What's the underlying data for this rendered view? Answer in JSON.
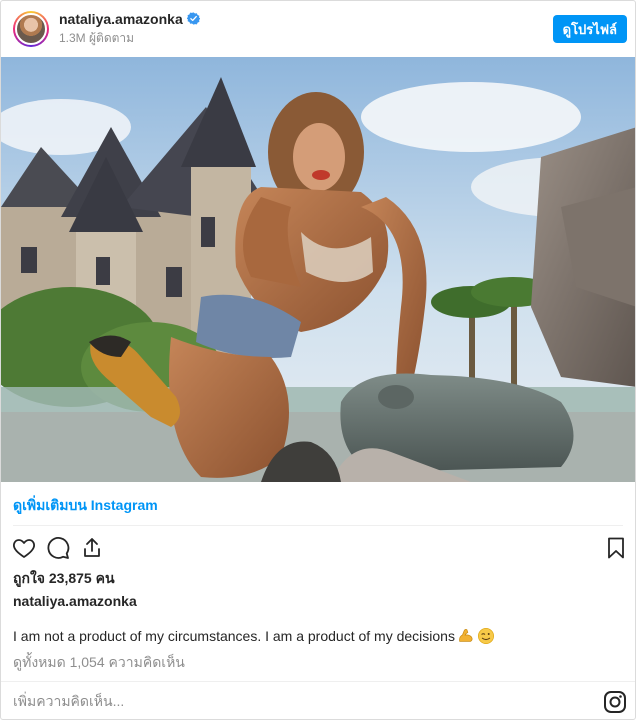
{
  "header": {
    "username": "nataliya.amazonka",
    "followers": "1.3M ผู้ติดตาม",
    "view_profile_label": "ดูโปรไฟล์"
  },
  "more_link": "ดูเพิ่มเติมบน Instagram",
  "likes": "ถูกใจ 23,875 คน",
  "caption_username": "nataliya.amazonka",
  "caption_text": "I am not a product of my circumstances. I am a product of my decisions",
  "caption_emojis": [
    "flexed-biceps",
    "winking-face"
  ],
  "comments_link": "ดูทั้งหมด 1,054 ความคิดเห็น",
  "add_comment_placeholder": "เพิ่มความคิดเห็น...",
  "colors": {
    "accent": "#0095f6",
    "verified": "#3897f0",
    "muted": "#8e8e8e",
    "text": "#262626"
  },
  "icons": {
    "like": "heart-icon",
    "comment": "comment-icon",
    "share": "share-icon",
    "save": "bookmark-icon",
    "brand": "instagram-logo-icon"
  }
}
